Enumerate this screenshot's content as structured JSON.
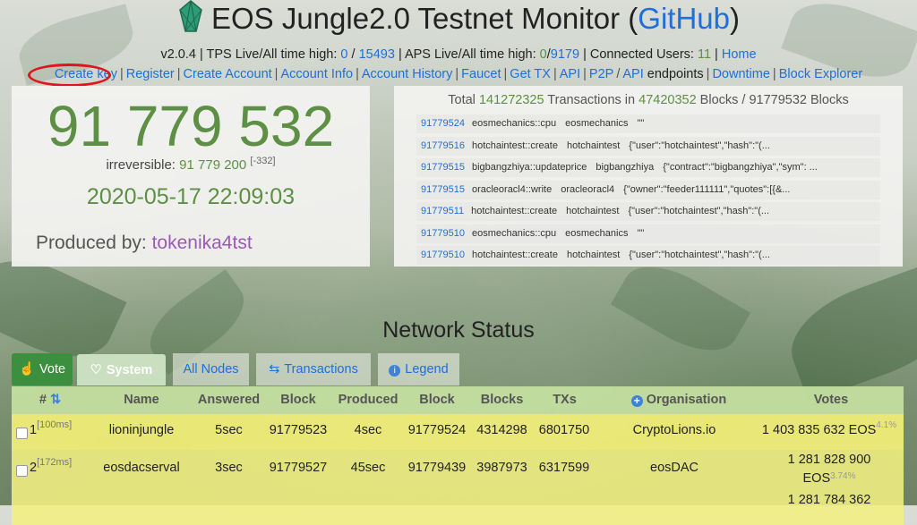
{
  "header": {
    "title": "EOS Jungle2.0 Testnet Monitor",
    "github_label": "GitHub"
  },
  "stats": {
    "version": "v2.0.4",
    "tps_label": "TPS Live/All time high:",
    "tps_live": "0",
    "tps_high": "15493",
    "aps_label": "APS Live/All time high:",
    "aps_live": "0",
    "aps_high": "9179",
    "users_label": "Connected Users:",
    "users": "11",
    "home": "Home"
  },
  "nav": {
    "create_key": "Create key",
    "register": "Register",
    "create_account": "Create Account",
    "account_info": "Account Info",
    "account_history": "Account History",
    "faucet": "Faucet",
    "get_tx": "Get TX",
    "api": "API",
    "p2p": "P2P",
    "api2": "API",
    "endpoints": "endpoints",
    "downtime": "Downtime",
    "block_explorer": "Block Explorer"
  },
  "head_block": {
    "number": "91 779 532",
    "irr_label": "irreversible:",
    "irr_value": "91 779 200",
    "irr_diff": "[-332]",
    "datetime": "2020-05-17 22:09:03",
    "produced_label": "Produced by:",
    "producer": "tokenika4tst"
  },
  "totals": {
    "total_label": "Total",
    "transactions": "141272325",
    "tx_label": "Transactions in",
    "blocks": "47420352",
    "blocks_label": "Blocks /",
    "all_blocks": "91779532",
    "all_blocks_label": "Blocks"
  },
  "transactions": [
    {
      "block": "91779524",
      "action": "eosmechanics::cpu",
      "account": "eosmechanics",
      "data": "\"\""
    },
    {
      "block": "91779516",
      "action": "hotchaintest::create",
      "account": "hotchaintest",
      "data": "{\"user\":\"hotchaintest\",\"hash\":\"(..."
    },
    {
      "block": "91779515",
      "action": "bigbangzhiya::updateprice",
      "account": "bigbangzhiya",
      "data": "{\"contract\":\"bigbangzhiya\",\"sym\": ..."
    },
    {
      "block": "91779515",
      "action": "oracleoracl4::write",
      "account": "oracleoracl4",
      "data": "{\"owner\":\"feeder111111\",\"quotes\":[{&..."
    },
    {
      "block": "91779511",
      "action": "hotchaintest::create",
      "account": "hotchaintest",
      "data": "{\"user\":\"hotchaintest\",\"hash\":\"(..."
    },
    {
      "block": "91779510",
      "action": "eosmechanics::cpu",
      "account": "eosmechanics",
      "data": "\"\""
    },
    {
      "block": "91779510",
      "action": "hotchaintest::create",
      "account": "hotchaintest",
      "data": "{\"user\":\"hotchaintest\",\"hash\":\"(..."
    }
  ],
  "network": {
    "title": "Network Status",
    "tabs": {
      "vote": "Vote",
      "system": "System",
      "nodes": "All Nodes",
      "transactions": "Transactions",
      "legend": "Legend"
    },
    "columns": {
      "num": "#",
      "name": "Name",
      "answered": "Answered",
      "block": "Block",
      "produced": "Produced",
      "block2": "Block",
      "blocks": "Blocks",
      "txs": "TXs",
      "org": "Organisation",
      "votes": "Votes"
    },
    "rows": [
      {
        "num": "1",
        "ms": "[100ms]",
        "name": "lioninjungle",
        "answered": "5sec",
        "block": "91779523",
        "produced": "4sec",
        "block2": "91779524",
        "blocks": "4314298",
        "txs": "6801750",
        "org": "CryptoLions.io",
        "votes": "1 403 835 632 EOS",
        "pct": "4.1%"
      },
      {
        "num": "2",
        "ms": "[172ms]",
        "name": "eosdacserval",
        "answered": "3sec",
        "block": "91779527",
        "produced": "45sec",
        "block2": "91779439",
        "blocks": "3987973",
        "txs": "6317599",
        "org": "eosDAC",
        "votes_l1": "1 281 828 900",
        "votes_l2": "EOS",
        "pct": "3.74%"
      },
      {
        "votes_l1": "1 281 784 362"
      }
    ]
  },
  "colors": {
    "accent_green": "#5d8f45",
    "link_blue": "#1e6fd9",
    "producer_purple": "#9b59b6",
    "row_yellow": "#f3f078",
    "header_green": "#c4dea0",
    "annotation_red": "#e0151b"
  }
}
